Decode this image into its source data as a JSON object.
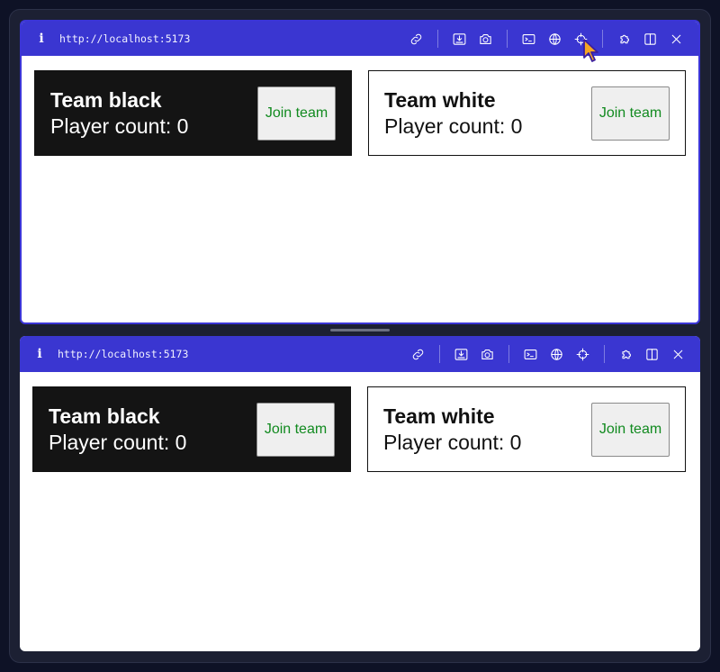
{
  "panes": [
    {
      "url": "http://localhost:5173",
      "teams": [
        {
          "title": "Team black",
          "count_text": "Player count: 0",
          "button": "Join team"
        },
        {
          "title": "Team white",
          "count_text": "Player count: 0",
          "button": "Join team"
        }
      ]
    },
    {
      "url": "http://localhost:5173",
      "teams": [
        {
          "title": "Team black",
          "count_text": "Player count: 0",
          "button": "Join team"
        },
        {
          "title": "Team white",
          "count_text": "Player count: 0",
          "button": "Join team"
        }
      ]
    }
  ],
  "toolbar_icons": [
    "info-icon",
    "link-icon",
    "download-icon",
    "camera-icon",
    "terminal-icon",
    "globe-icon",
    "crosshair-icon",
    "puzzle-icon",
    "split-view-icon",
    "close-icon"
  ],
  "colors": {
    "toolbar": "#3a36d1",
    "active_border": "#3b35d6",
    "button_text": "#118a1f",
    "black_card": "#141414"
  }
}
